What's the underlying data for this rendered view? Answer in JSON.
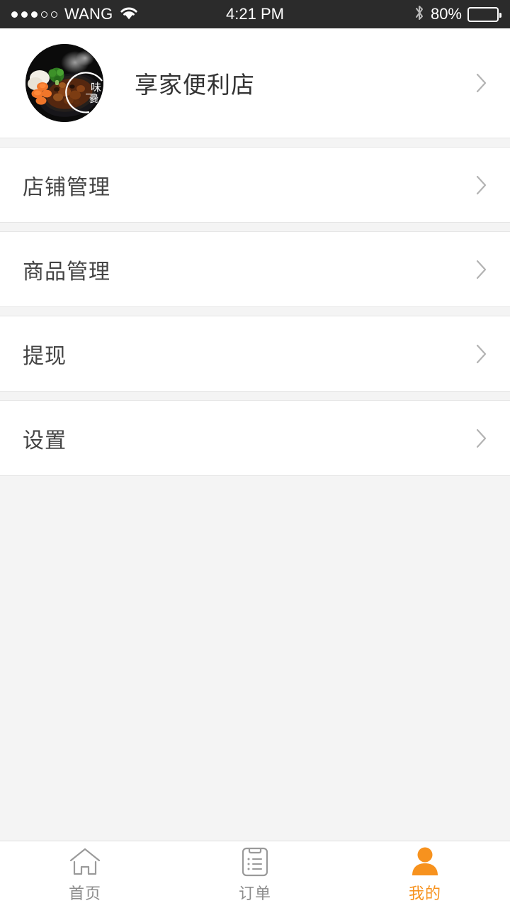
{
  "status_bar": {
    "signal_dots": {
      "filled": 3,
      "hollow": 2
    },
    "carrier": "WANG",
    "wifi_icon": "wifi-icon",
    "time": "4:21 PM",
    "bluetooth_icon": "bluetooth-icon",
    "battery_percent": "80%",
    "battery_level": 80
  },
  "profile": {
    "avatar_alt": "shop-avatar-food-photo",
    "shop_name": "享家便利店",
    "chevron": "chevron-right-icon"
  },
  "menu": [
    {
      "label": "店铺管理",
      "name": "store-management",
      "chevron": "chevron-right-icon"
    },
    {
      "label": "商品管理",
      "name": "product-management",
      "chevron": "chevron-right-icon"
    },
    {
      "label": "提现",
      "name": "withdraw",
      "chevron": "chevron-right-icon"
    },
    {
      "label": "设置",
      "name": "settings",
      "chevron": "chevron-right-icon"
    }
  ],
  "tabbar": {
    "active_color": "#f7921e",
    "inactive_color": "#8c8c8c",
    "tabs": [
      {
        "label": "首页",
        "icon": "home-icon",
        "active": false
      },
      {
        "label": "订单",
        "icon": "clipboard-order-icon",
        "active": false
      },
      {
        "label": "我的",
        "icon": "person-profile-icon",
        "active": true
      }
    ]
  },
  "colors": {
    "accent": "#f7921e",
    "page_background": "#f4f4f4",
    "card_background": "#ffffff",
    "divider": "#e6e6e6",
    "status_bar_background": "#2b2b2b",
    "primary_text": "#333333",
    "secondary_text": "#444444"
  }
}
